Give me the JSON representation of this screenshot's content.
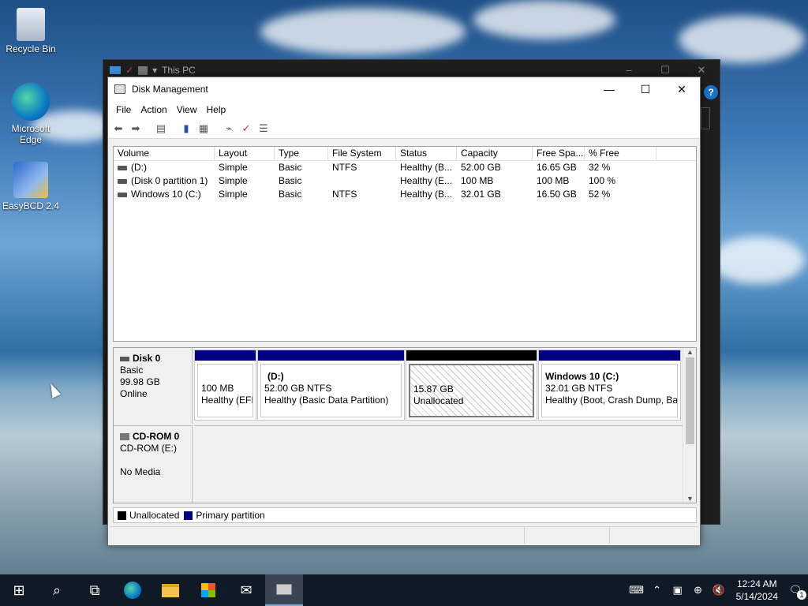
{
  "desktop": {
    "icons": [
      {
        "label": "Recycle Bin"
      },
      {
        "label": "Microsoft Edge"
      },
      {
        "label": "EasyBCD 2.4"
      }
    ]
  },
  "background_window": {
    "title": "This PC"
  },
  "window": {
    "title": "Disk Management",
    "menu": [
      "File",
      "Action",
      "View",
      "Help"
    ]
  },
  "volume_list": {
    "columns": [
      "Volume",
      "Layout",
      "Type",
      "File System",
      "Status",
      "Capacity",
      "Free Spa...",
      "% Free"
    ],
    "rows": [
      [
        "(D:)",
        "Simple",
        "Basic",
        "NTFS",
        "Healthy (B...",
        "52.00 GB",
        "16.65 GB",
        "32 %"
      ],
      [
        "(Disk 0 partition 1)",
        "Simple",
        "Basic",
        "",
        "Healthy (E...",
        "100 MB",
        "100 MB",
        "100 %"
      ],
      [
        "Windows 10 (C:)",
        "Simple",
        "Basic",
        "NTFS",
        "Healthy (B...",
        "32.01 GB",
        "16.50 GB",
        "52 %"
      ]
    ]
  },
  "disks": {
    "disk0": {
      "name": "Disk 0",
      "type": "Basic",
      "size": "99.98 GB",
      "state": "Online"
    },
    "cdrom0": {
      "name": "CD-ROM 0",
      "drive": "CD-ROM (E:)",
      "media": "No Media"
    }
  },
  "partitions": {
    "efi": {
      "size": "100 MB",
      "status": "Healthy (EFI"
    },
    "d": {
      "name": "(D:)",
      "size": "52.00 GB NTFS",
      "status": "Healthy (Basic Data Partition)"
    },
    "unallocated": {
      "size": "15.87 GB",
      "status": "Unallocated"
    },
    "c": {
      "name": "Windows 10  (C:)",
      "size": "32.01 GB NTFS",
      "status": "Healthy (Boot, Crash Dump, Ba"
    }
  },
  "legend": {
    "unallocated": "Unallocated",
    "primary": "Primary partition"
  },
  "colors": {
    "primary": "#000080",
    "unallocated": "#000000"
  },
  "taskbar": {
    "time": "12:24 AM",
    "date": "5/14/2024",
    "notification_count": "1"
  }
}
